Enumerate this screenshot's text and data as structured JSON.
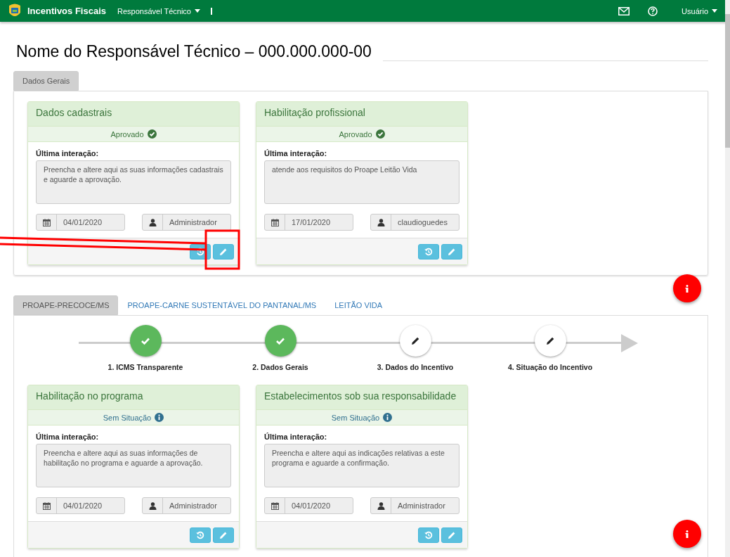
{
  "navbar": {
    "brand": "Incentivos Fiscais",
    "menu": "Responsável Técnico",
    "user_menu": "Usuário"
  },
  "page_title": "Nome do Responsável Técnico – 000.000.000-00",
  "general_tabs": [
    {
      "label": "Dados Gerais",
      "selected": true
    }
  ],
  "general_cards": [
    {
      "title": "Dados cadastrais",
      "status": "Aprovado",
      "kind": "approved",
      "interaction_label": "Última interação:",
      "message": "Preencha e altere aqui as suas informações cadastrais e aguarde a aprovação.",
      "date": "04/01/2020",
      "user": "Administrador"
    },
    {
      "title": "Habilitação profissional",
      "status": "Aprovado",
      "kind": "approved",
      "interaction_label": "Última interação:",
      "message": "atende aos requisitos do Proape Leitão Vida",
      "date": "17/01/2020",
      "user": "claudioguedes"
    }
  ],
  "program_tabs": [
    {
      "label": "PROAPE-PRECOCE/MS",
      "selected": true
    },
    {
      "label": "PROAPE-CARNE SUSTENTÁVEL DO PANTANAL/MS",
      "selected": false
    },
    {
      "label": "LEITÃO VIDA",
      "selected": false
    }
  ],
  "steps": [
    {
      "label": "1. ICMS Transparente",
      "done": true
    },
    {
      "label": "2. Dados Gerais",
      "done": true
    },
    {
      "label": "3. Dados do Incentivo",
      "done": false
    },
    {
      "label": "4. Situação do Incentivo",
      "done": false
    }
  ],
  "program_cards": [
    {
      "title": "Habilitação no programa",
      "status": "Sem Situação",
      "kind": "none",
      "interaction_label": "Última interação:",
      "message": "Preencha e altere aqui as suas informações de habilitação no programa e aguarde a aprovação.",
      "date": "04/01/2020",
      "user": "Administrador"
    },
    {
      "title": "Estabelecimentos sob sua responsabilidade",
      "status": "Sem Situação",
      "kind": "none",
      "interaction_label": "Última interação:",
      "message": "Preencha e altere aqui as indicações relativas a este programa e aguarde a confirmação.",
      "date": "04/01/2020",
      "user": "Administrador"
    }
  ]
}
